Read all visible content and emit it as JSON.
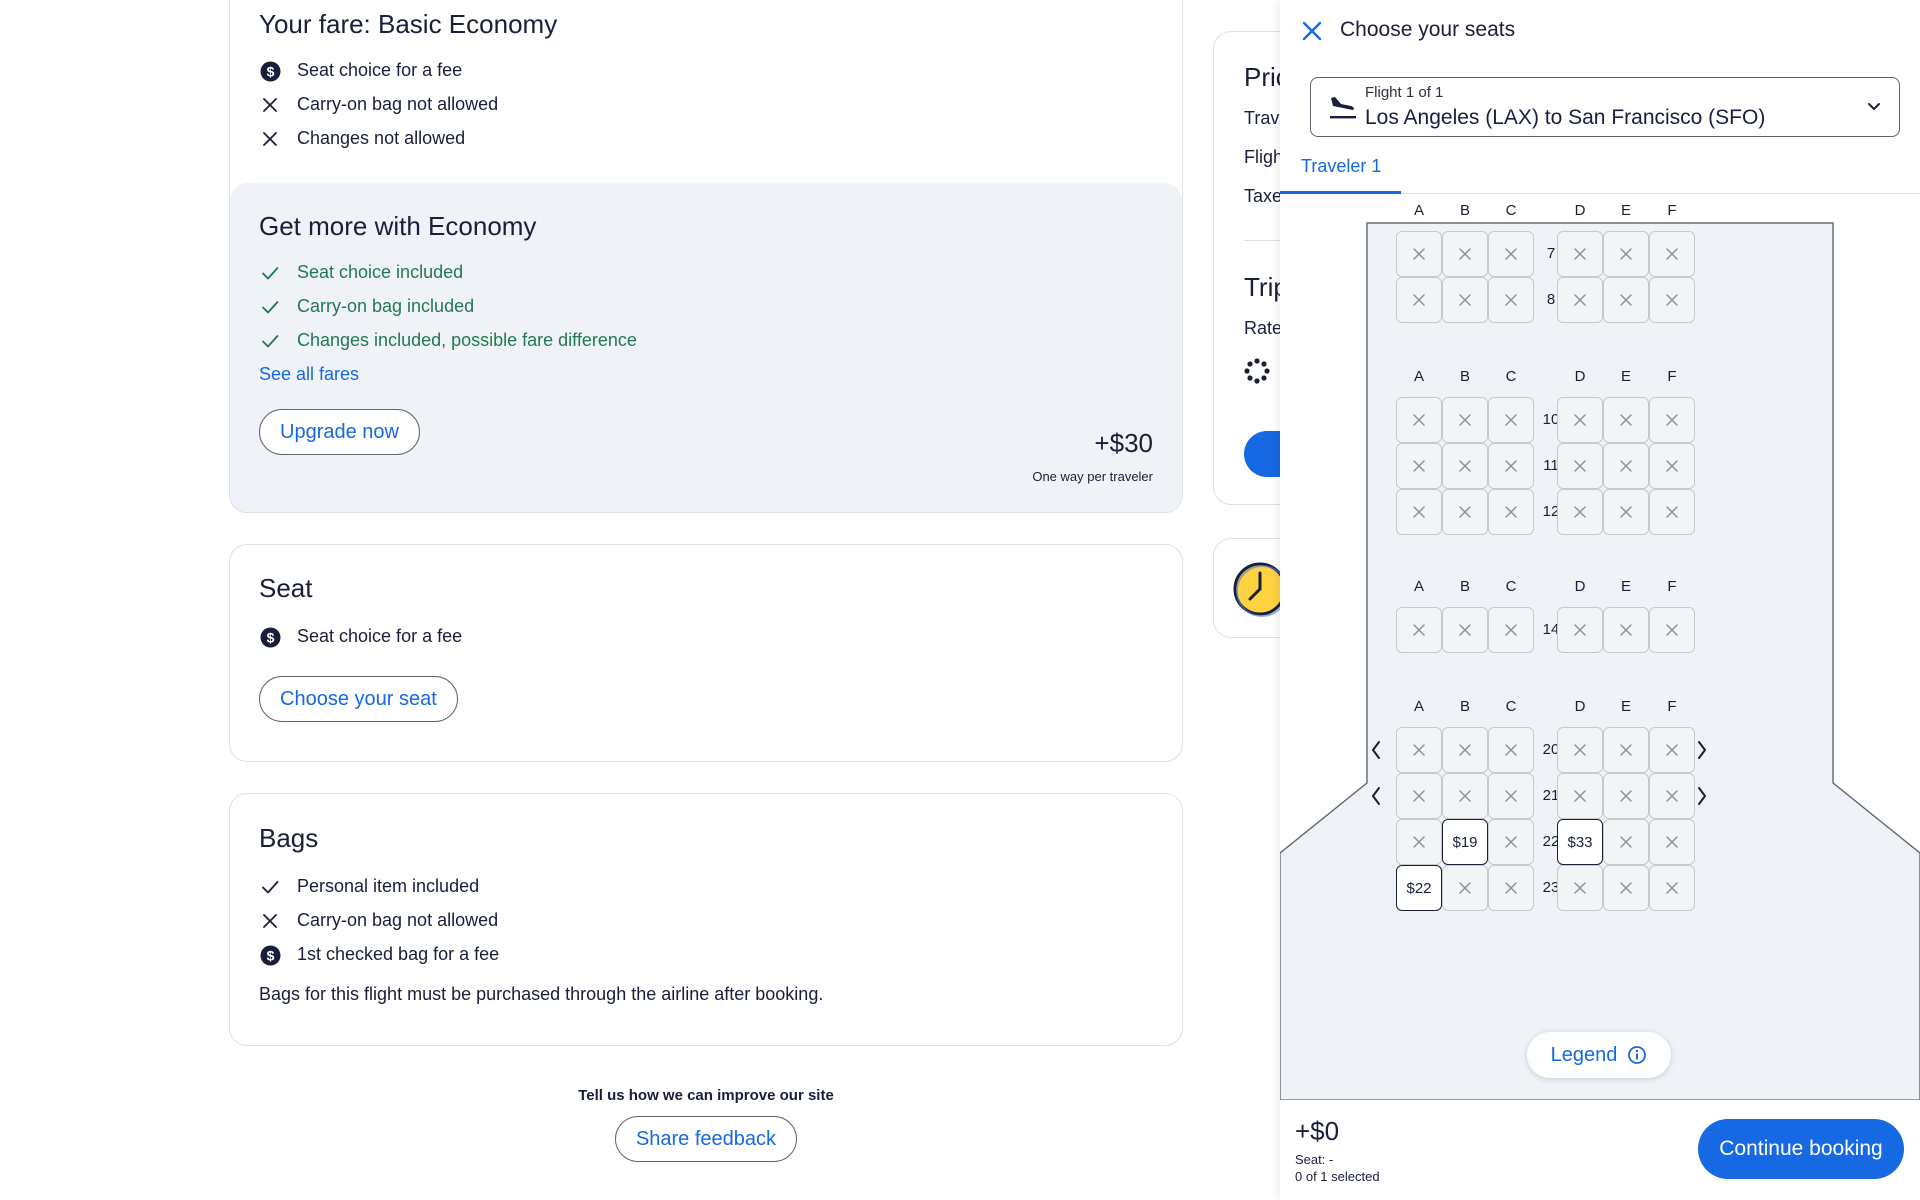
{
  "fare": {
    "title": "Your fare: Basic Economy",
    "features": [
      {
        "icon": "dollar-circle-icon",
        "text": "Seat choice for a fee"
      },
      {
        "icon": "x-icon",
        "text": "Carry-on bag not allowed"
      },
      {
        "icon": "x-icon",
        "text": "Changes not allowed"
      }
    ]
  },
  "upsell": {
    "title": "Get more with Economy",
    "features": [
      {
        "icon": "check-icon",
        "text": "Seat choice included"
      },
      {
        "icon": "check-icon",
        "text": "Carry-on bag included"
      },
      {
        "icon": "check-icon",
        "text": "Changes included, possible fare difference"
      }
    ],
    "see_all": "See all fares",
    "upgrade_label": "Upgrade now",
    "price": "+$30",
    "price_note": "One way per traveler"
  },
  "seat_section": {
    "title": "Seat",
    "feature": {
      "icon": "dollar-circle-icon",
      "text": "Seat choice for a fee"
    },
    "button": "Choose your seat"
  },
  "bags": {
    "title": "Bags",
    "features": [
      {
        "icon": "check-icon",
        "text": "Personal item included"
      },
      {
        "icon": "x-icon",
        "text": "Carry-on bag not allowed"
      },
      {
        "icon": "dollar-circle-icon",
        "text": "1st checked bag for a fee"
      }
    ],
    "note": "Bags for this flight must be purchased through the airline after booking."
  },
  "feedback": {
    "question": "Tell us how we can improve our site",
    "button": "Share feedback"
  },
  "price_card": {
    "title": "Pric",
    "lines": [
      "Trav",
      "Fligh",
      "Taxe"
    ],
    "trip_title": "Trip",
    "trip_line": "Rate"
  },
  "drawer": {
    "title": "Choose your seats",
    "flight_small": "Flight 1 of 1",
    "flight_route": "Los Angeles (LAX) to San Francisco (SFO)",
    "tab": "Traveler 1",
    "legend": "Legend",
    "total": "+$0",
    "seat_info": "Seat: -",
    "selected_info": "0 of 1 selected",
    "continue": "Continue booking"
  },
  "seatmap": {
    "columns": [
      "A",
      "B",
      "C",
      "D",
      "E",
      "F"
    ],
    "sections": [
      {
        "rows": [
          "7",
          "8"
        ]
      },
      {
        "rows": [
          "10",
          "11",
          "12"
        ]
      },
      {
        "rows": [
          "14"
        ]
      },
      {
        "rows": [
          "20",
          "21",
          "22",
          "23"
        ]
      }
    ],
    "available": [
      {
        "row": "22",
        "col": "B",
        "price": "$19"
      },
      {
        "row": "22",
        "col": "D",
        "price": "$33"
      },
      {
        "row": "23",
        "col": "A",
        "price": "$22"
      }
    ],
    "exit_rows": [
      "20",
      "21"
    ]
  }
}
